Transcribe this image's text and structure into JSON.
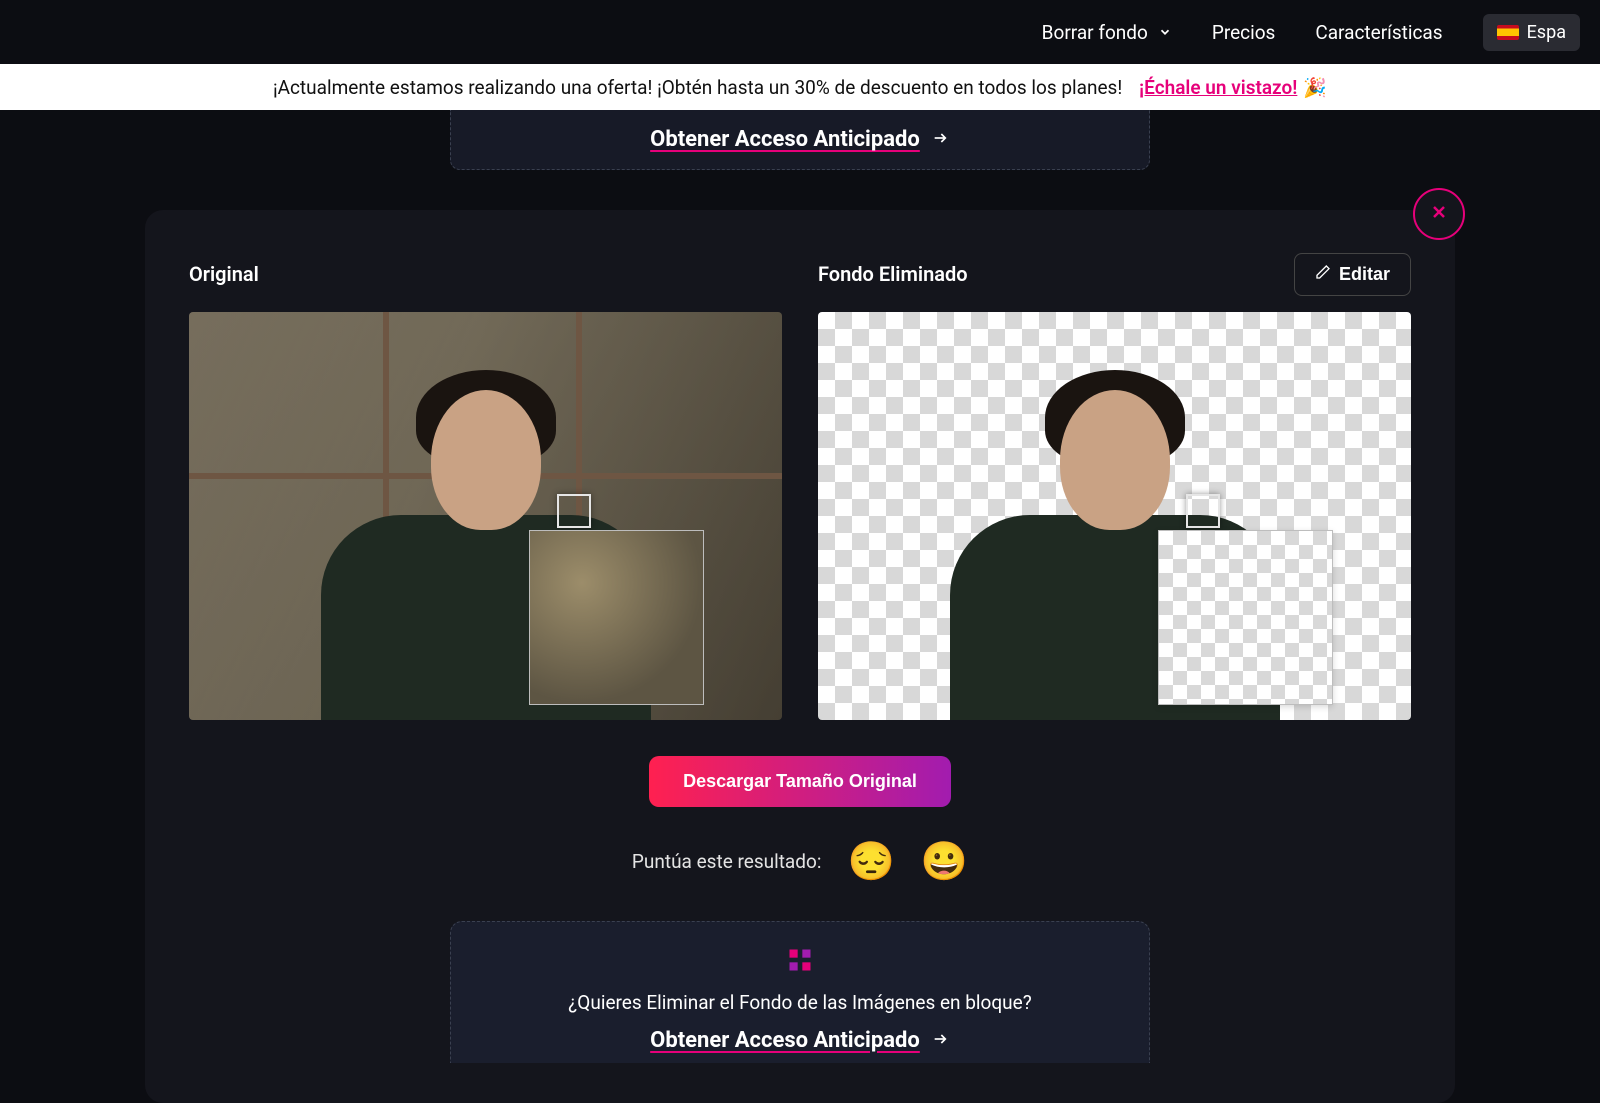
{
  "nav": {
    "items": [
      {
        "label": "Borrar fondo"
      },
      {
        "label": "Precios"
      },
      {
        "label": "Características"
      }
    ],
    "language": "Espa"
  },
  "promo": {
    "text": "¡Actualmente estamos realizando una oferta! ¡Obtén hasta un 30% de descuento en todos los planes!",
    "link": "¡Échale un vistazo!",
    "emoji": "🎉"
  },
  "early_access": {
    "label": "Obtener Acceso Anticipado"
  },
  "result": {
    "original_label": "Original",
    "removed_label": "Fondo Eliminado",
    "edit_label": "Editar",
    "download_label": "Descargar Tamaño Original",
    "rate_label": "Puntúa este resultado:",
    "rate_bad": "😔",
    "rate_good": "😀"
  },
  "bulk": {
    "question": "¿Quieres Eliminar el Fondo de las Imágenes en bloque?",
    "cta": "Obtener Acceso Anticipado"
  }
}
